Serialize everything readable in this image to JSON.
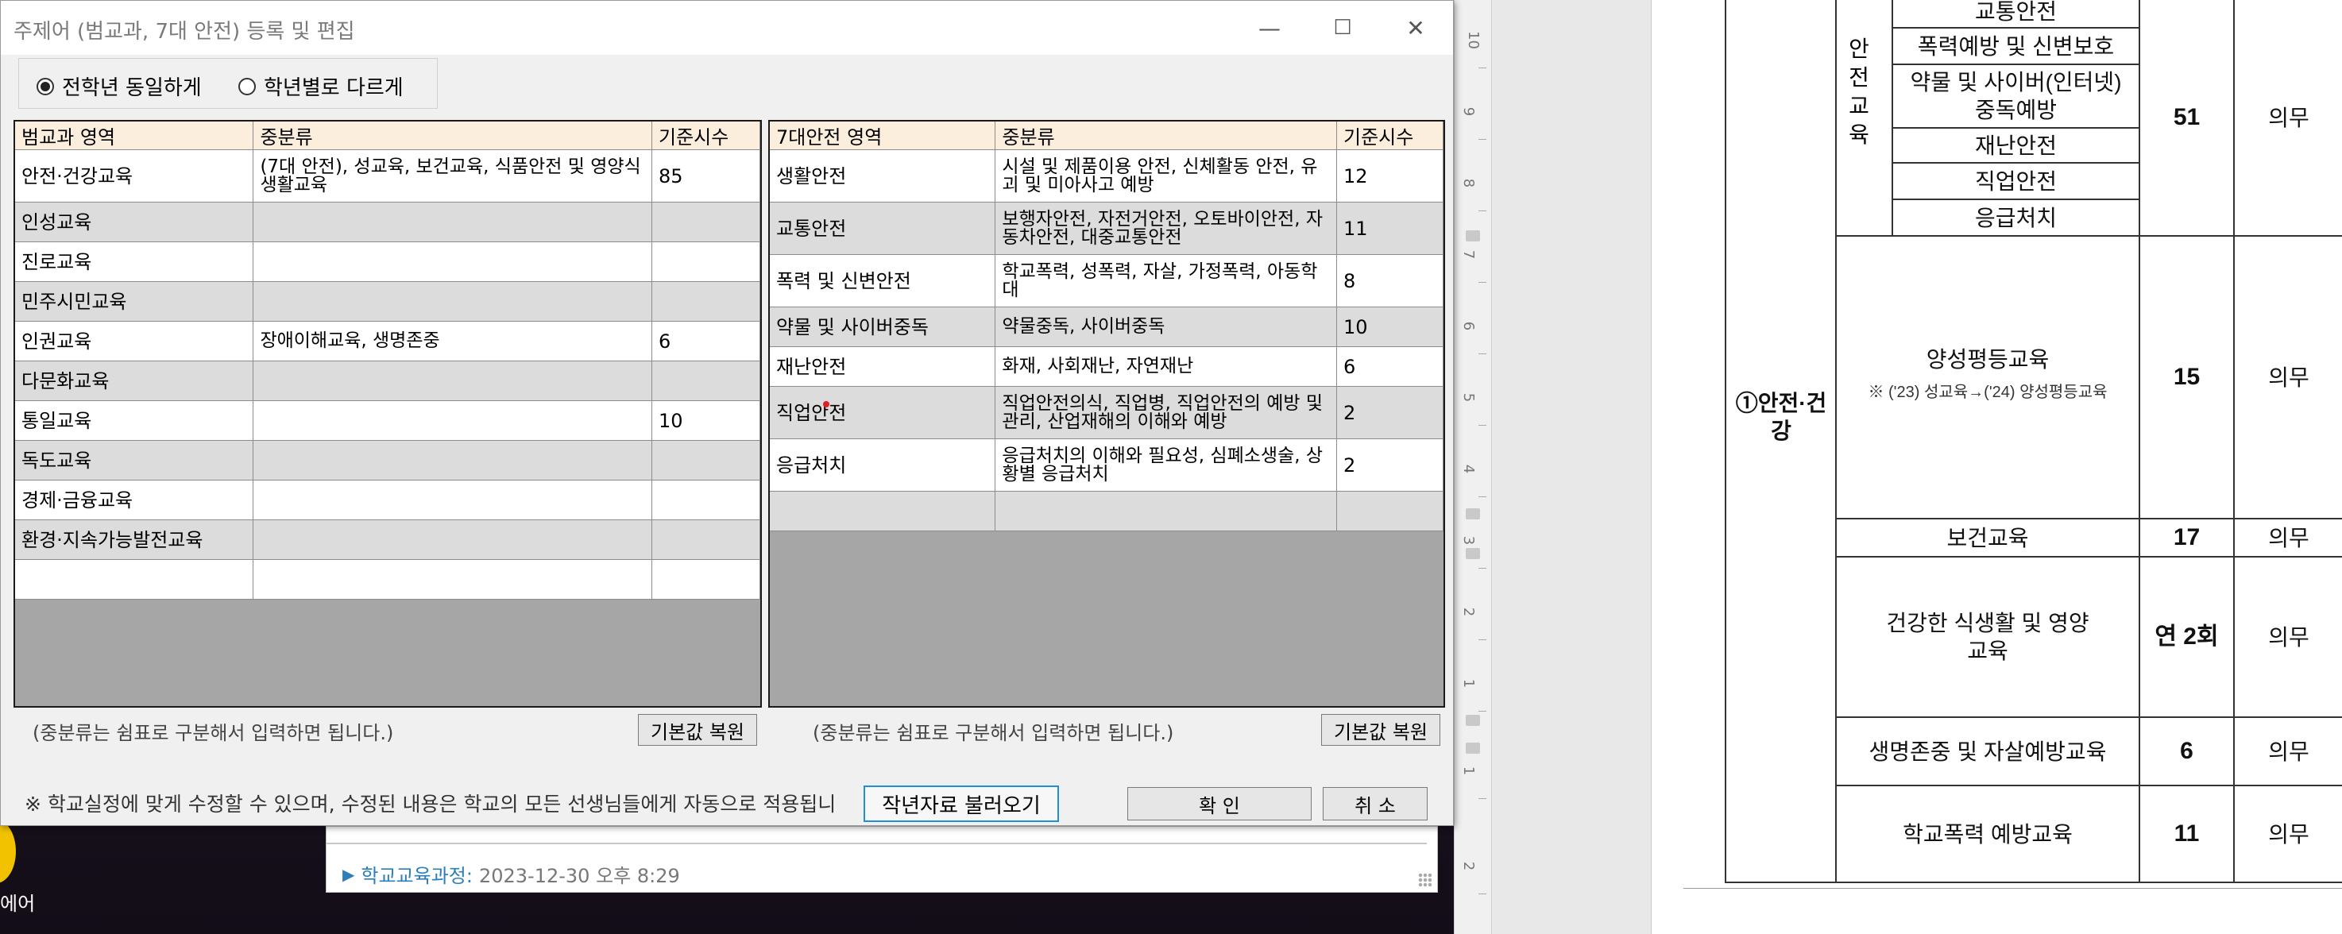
{
  "dialog": {
    "title": "주제어 (범교과, 7대 안전) 등록 및 편집",
    "window_buttons": [
      "—",
      "☐",
      "✕"
    ],
    "radio_options": [
      {
        "label": "전학년 동일하게",
        "selected": true
      },
      {
        "label": "학년별로 다르게",
        "selected": false
      }
    ],
    "left_table": {
      "headers": [
        "범교과 영역",
        "중분류",
        "기준시수"
      ],
      "rows": [
        [
          "안전·건강교육",
          "(7대 안전), 성교육, 보건교육, 식품안전 및 영양식생활교육",
          "85"
        ],
        [
          "인성교육",
          "",
          ""
        ],
        [
          "진로교육",
          "",
          ""
        ],
        [
          "민주시민교육",
          "",
          ""
        ],
        [
          "인권교육",
          "장애이해교육, 생명존중",
          "6"
        ],
        [
          "다문화교육",
          "",
          ""
        ],
        [
          "통일교육",
          "",
          "10"
        ],
        [
          "독도교육",
          "",
          ""
        ],
        [
          "경제·금융교육",
          "",
          ""
        ],
        [
          "환경·지속가능발전교육",
          "",
          ""
        ],
        [
          "",
          "",
          ""
        ]
      ]
    },
    "right_table": {
      "headers": [
        "7대안전 영역",
        "중분류",
        "기준시수"
      ],
      "rows": [
        [
          "생활안전",
          "시설 및 제품이용 안전, 신체활동 안전, 유괴 및 미아사고 예방",
          "12"
        ],
        [
          "교통안전",
          "보행자안전, 자전거안전, 오토바이안전, 자동차안전, 대중교통안전",
          "11"
        ],
        [
          "폭력 및 신변안전",
          "학교폭력, 성폭력, 자살, 가정폭력, 아동학대",
          "8"
        ],
        [
          "약물 및 사이버중독",
          "약물중독, 사이버중독",
          "10"
        ],
        [
          "재난안전",
          "화재, 사회재난, 자연재난",
          "6"
        ],
        [
          "직업안전",
          "직업안전의식, 직업병, 직업안전의 예방 및 관리, 산업재해의 이해와 예방",
          "2"
        ],
        [
          "응급처치",
          "응급처치의 이해와 필요성, 심폐소생술, 상황별 응급처치",
          "2"
        ],
        [
          "",
          "",
          ""
        ]
      ]
    },
    "hint_left": "(중분류는 쉼표로 구분해서 입력하면 됩니다.)",
    "hint_right": "(중분류는 쉼표로 구분해서 입력하면 됩니다.)",
    "restore_button": "기본값 복원",
    "notice": "※ 학교실정에 맞게 수정할 수 있으며, 수정된 내용은 학교의 모든 선생님들에게 자동으로 적용됩니",
    "load_prev_button": "작년자료 불러오기",
    "ok_button": "확 인",
    "cancel_button": "취 소"
  },
  "background": {
    "left_label": "에어",
    "footer_link": "학교교육과정:",
    "footer_time": "2023-12-30 오후 8:29"
  },
  "ruler": {
    "numbers": [
      "10",
      "9",
      "8",
      "7",
      "6",
      "5",
      "4",
      "3",
      "2",
      "1",
      "1",
      "2"
    ]
  },
  "document": {
    "safety_vertical": "안전교육",
    "sub_rows": [
      "교통안전",
      "폭력예방 및 신변보호",
      "약물 및 사이버(인터넷) 중독예방",
      "재난안전",
      "직업안전",
      "응급처치"
    ],
    "safety_hours": "51",
    "mandatory": "의무",
    "category": "①안전·건강",
    "rows": [
      {
        "name": "양성평등교육",
        "note": "※ ('23) 성교육→('24) 양성평등교육",
        "hours": "15",
        "status": "의무"
      },
      {
        "name": "보건교육",
        "note": "",
        "hours": "17",
        "status": "의무"
      },
      {
        "name": "건강한 식생활 및 영양교육",
        "note": "",
        "hours": "연 2회",
        "status": "의무"
      },
      {
        "name": "생명존중 및 자살예방교육",
        "note": "",
        "hours": "6",
        "status": "의무"
      },
      {
        "name": "학교폭력 예방교육",
        "note": "",
        "hours": "11",
        "status": "의무"
      }
    ]
  }
}
